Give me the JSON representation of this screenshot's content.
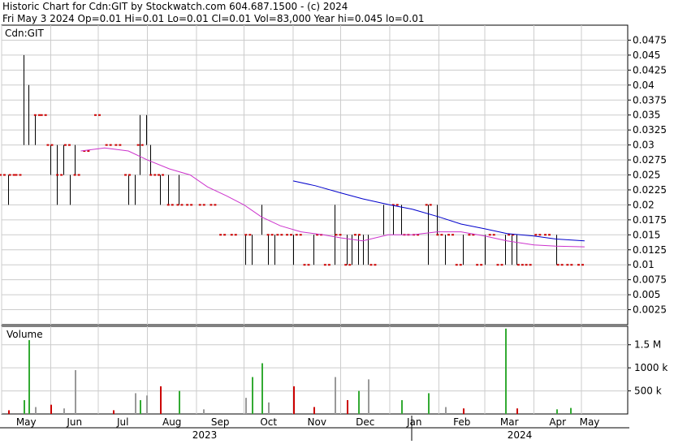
{
  "header": {
    "line1": "Historic Chart for Cdn:GIT by Stockwatch.com 604.687.1500 - (c) 2024",
    "line2": "Fri May  3 2024   Op=0.01  Hi=0.01  Lo=0.01  Cl=0.01  Vol=83,000  Year hi=0.045  lo=0.01"
  },
  "chart_data": [
    {
      "type": "ohlc",
      "title": "Cdn:GIT",
      "x_axis": {
        "months": [
          "May",
          "Jun",
          "Jul",
          "Aug",
          "Sep",
          "Oct",
          "Nov",
          "Dec",
          "Jan",
          "Feb",
          "Mar",
          "Apr",
          "May"
        ],
        "years": [
          "2023",
          "2024"
        ]
      },
      "y_axis": {
        "ticks": [
          "0.0475",
          "0.045",
          "0.0425",
          "0.04",
          "0.0375",
          "0.035",
          "0.0325",
          "0.03",
          "0.0275",
          "0.025",
          "0.0225",
          "0.02",
          "0.0175",
          "0.015",
          "0.0125",
          "0.01",
          "0.0075",
          "0.005",
          "0.0025"
        ],
        "ylim": [
          0,
          0.05
        ]
      },
      "grid": true,
      "series": [
        {
          "color": "#000000",
          "bars": [
            {
              "x": "2023-05-05",
              "h": 0.025,
              "l": 0.02
            },
            {
              "x": "2023-05-15",
              "h": 0.045,
              "l": 0.03
            },
            {
              "x": "2023-05-18",
              "h": 0.04,
              "l": 0.03
            },
            {
              "x": "2023-05-22",
              "h": 0.035,
              "l": 0.03
            },
            {
              "x": "2023-06-01",
              "h": 0.03,
              "l": 0.025
            },
            {
              "x": "2023-06-05",
              "h": 0.03,
              "l": 0.02
            },
            {
              "x": "2023-06-09",
              "h": 0.03,
              "l": 0.025
            },
            {
              "x": "2023-06-13",
              "h": 0.025,
              "l": 0.02
            },
            {
              "x": "2023-06-16",
              "h": 0.03,
              "l": 0.025
            },
            {
              "x": "2023-07-20",
              "h": 0.025,
              "l": 0.02
            },
            {
              "x": "2023-07-24",
              "h": 0.025,
              "l": 0.02
            },
            {
              "x": "2023-07-27",
              "h": 0.035,
              "l": 0.025
            },
            {
              "x": "2023-07-31",
              "h": 0.035,
              "l": 0.03
            },
            {
              "x": "2023-08-03",
              "h": 0.03,
              "l": 0.025
            },
            {
              "x": "2023-08-09",
              "h": 0.025,
              "l": 0.02
            },
            {
              "x": "2023-08-14",
              "h": 0.025,
              "l": 0.02
            },
            {
              "x": "2023-08-21",
              "h": 0.025,
              "l": 0.02
            },
            {
              "x": "2023-10-02",
              "h": 0.015,
              "l": 0.01
            },
            {
              "x": "2023-10-06",
              "h": 0.015,
              "l": 0.01
            },
            {
              "x": "2023-10-12",
              "h": 0.02,
              "l": 0.015
            },
            {
              "x": "2023-10-16",
              "h": 0.015,
              "l": 0.01
            },
            {
              "x": "2023-10-20",
              "h": 0.015,
              "l": 0.01
            },
            {
              "x": "2023-11-01",
              "h": 0.015,
              "l": 0.01
            },
            {
              "x": "2023-11-14",
              "h": 0.015,
              "l": 0.01
            },
            {
              "x": "2023-11-27",
              "h": 0.02,
              "l": 0.01
            },
            {
              "x": "2023-12-05",
              "h": 0.015,
              "l": 0.01
            },
            {
              "x": "2023-12-08",
              "h": 0.015,
              "l": 0.01
            },
            {
              "x": "2023-12-12",
              "h": 0.015,
              "l": 0.01
            },
            {
              "x": "2023-12-15",
              "h": 0.015,
              "l": 0.01
            },
            {
              "x": "2023-12-18",
              "h": 0.015,
              "l": 0.01
            },
            {
              "x": "2023-12-28",
              "h": 0.02,
              "l": 0.015
            },
            {
              "x": "2024-01-03",
              "h": 0.02,
              "l": 0.015
            },
            {
              "x": "2024-01-08",
              "h": 0.02,
              "l": 0.015
            },
            {
              "x": "2024-01-25",
              "h": 0.02,
              "l": 0.01
            },
            {
              "x": "2024-01-31",
              "h": 0.02,
              "l": 0.015
            },
            {
              "x": "2024-02-05",
              "h": 0.015,
              "l": 0.01
            },
            {
              "x": "2024-02-16",
              "h": 0.015,
              "l": 0.01
            },
            {
              "x": "2024-03-01",
              "h": 0.015,
              "l": 0.01
            },
            {
              "x": "2024-03-14",
              "h": 0.015,
              "l": 0.01
            },
            {
              "x": "2024-03-18",
              "h": 0.015,
              "l": 0.01
            },
            {
              "x": "2024-03-21",
              "h": 0.015,
              "l": 0.01
            },
            {
              "x": "2024-04-15",
              "h": 0.015,
              "l": 0.01
            }
          ]
        },
        {
          "color": "#cc0000",
          "ticks": [
            {
              "x": "2023-05-02",
              "v": 0.025
            },
            {
              "x": "2023-05-08",
              "v": 0.025
            },
            {
              "x": "2023-05-12",
              "v": 0.025
            },
            {
              "x": "2023-05-24",
              "v": 0.035
            },
            {
              "x": "2023-05-28",
              "v": 0.035
            },
            {
              "x": "2023-06-01",
              "v": 0.03
            },
            {
              "x": "2023-06-07",
              "v": 0.025
            },
            {
              "x": "2023-06-12",
              "v": 0.03
            },
            {
              "x": "2023-06-18",
              "v": 0.025
            },
            {
              "x": "2023-06-24",
              "v": 0.029
            },
            {
              "x": "2023-07-01",
              "v": 0.035
            },
            {
              "x": "2023-07-08",
              "v": 0.03
            },
            {
              "x": "2023-07-14",
              "v": 0.03
            },
            {
              "x": "2023-07-20",
              "v": 0.025
            },
            {
              "x": "2023-07-28",
              "v": 0.03
            },
            {
              "x": "2023-08-05",
              "v": 0.025
            },
            {
              "x": "2023-08-10",
              "v": 0.025
            },
            {
              "x": "2023-08-16",
              "v": 0.02
            },
            {
              "x": "2023-08-22",
              "v": 0.02
            },
            {
              "x": "2023-08-28",
              "v": 0.02
            },
            {
              "x": "2023-09-05",
              "v": 0.02
            },
            {
              "x": "2023-09-12",
              "v": 0.02
            },
            {
              "x": "2023-09-18",
              "v": 0.015
            },
            {
              "x": "2023-09-25",
              "v": 0.015
            },
            {
              "x": "2023-10-04",
              "v": 0.015
            },
            {
              "x": "2023-10-18",
              "v": 0.015
            },
            {
              "x": "2023-10-24",
              "v": 0.015
            },
            {
              "x": "2023-10-30",
              "v": 0.015
            },
            {
              "x": "2023-11-05",
              "v": 0.015
            },
            {
              "x": "2023-11-10",
              "v": 0.01
            },
            {
              "x": "2023-11-18",
              "v": 0.015
            },
            {
              "x": "2023-11-23",
              "v": 0.01
            },
            {
              "x": "2023-11-30",
              "v": 0.015
            },
            {
              "x": "2023-12-06",
              "v": 0.01
            },
            {
              "x": "2023-12-12",
              "v": 0.015
            },
            {
              "x": "2023-12-22",
              "v": 0.01
            },
            {
              "x": "2024-01-05",
              "v": 0.02
            },
            {
              "x": "2024-01-12",
              "v": 0.015
            },
            {
              "x": "2024-01-18",
              "v": 0.015
            },
            {
              "x": "2024-01-26",
              "v": 0.02
            },
            {
              "x": "2024-02-02",
              "v": 0.015
            },
            {
              "x": "2024-02-09",
              "v": 0.015
            },
            {
              "x": "2024-02-14",
              "v": 0.01
            },
            {
              "x": "2024-02-22",
              "v": 0.015
            },
            {
              "x": "2024-02-27",
              "v": 0.01
            },
            {
              "x": "2024-03-06",
              "v": 0.015
            },
            {
              "x": "2024-03-11",
              "v": 0.01
            },
            {
              "x": "2024-03-18",
              "v": 0.015
            },
            {
              "x": "2024-03-24",
              "v": 0.01
            },
            {
              "x": "2024-03-29",
              "v": 0.01
            },
            {
              "x": "2024-04-04",
              "v": 0.015
            },
            {
              "x": "2024-04-10",
              "v": 0.015
            },
            {
              "x": "2024-04-18",
              "v": 0.01
            },
            {
              "x": "2024-04-24",
              "v": 0.01
            },
            {
              "x": "2024-05-01",
              "v": 0.01
            }
          ]
        },
        {
          "color": "#cc33cc",
          "points": [
            [
              "2023-06-20",
              0.029
            ],
            [
              "2023-07-05",
              0.0295
            ],
            [
              "2023-07-20",
              0.029
            ],
            [
              "2023-08-01",
              0.0275
            ],
            [
              "2023-08-15",
              0.026
            ],
            [
              "2023-08-28",
              0.025
            ],
            [
              "2023-09-08",
              0.023
            ],
            [
              "2023-09-20",
              0.0215
            ],
            [
              "2023-10-01",
              0.02
            ],
            [
              "2023-10-12",
              0.018
            ],
            [
              "2023-10-24",
              0.0165
            ],
            [
              "2023-11-06",
              0.0155
            ],
            [
              "2023-11-20",
              0.015
            ],
            [
              "2023-12-01",
              0.0145
            ],
            [
              "2023-12-15",
              0.014
            ],
            [
              "2023-12-31",
              0.015
            ],
            [
              "2024-01-15",
              0.015
            ],
            [
              "2024-01-31",
              0.0155
            ],
            [
              "2024-02-15",
              0.0155
            ],
            [
              "2024-03-01",
              0.0148
            ],
            [
              "2024-03-15",
              0.014
            ],
            [
              "2024-04-01",
              0.0133
            ],
            [
              "2024-04-15",
              0.0131
            ],
            [
              "2024-05-03",
              0.013
            ]
          ]
        },
        {
          "color": "#0000cc",
          "points": [
            [
              "2023-11-01",
              0.024
            ],
            [
              "2023-11-15",
              0.0232
            ],
            [
              "2023-12-01",
              0.022
            ],
            [
              "2023-12-15",
              0.021
            ],
            [
              "2024-01-01",
              0.02
            ],
            [
              "2024-01-15",
              0.0193
            ],
            [
              "2024-02-01",
              0.018
            ],
            [
              "2024-02-15",
              0.0168
            ],
            [
              "2024-03-01",
              0.016
            ],
            [
              "2024-03-15",
              0.0152
            ],
            [
              "2024-04-01",
              0.0148
            ],
            [
              "2024-04-15",
              0.0143
            ],
            [
              "2024-05-03",
              0.014
            ]
          ]
        }
      ]
    },
    {
      "type": "bar",
      "title": "Volume",
      "y_axis": {
        "ticks": [
          "1.5 M",
          "1000 k",
          "500 k"
        ],
        "ylim": [
          0,
          1900000
        ]
      },
      "colors": {
        "up": "#33aa33",
        "down": "#cc0000",
        "flat": "#999999"
      },
      "bars": [
        {
          "x": "2023-05-05",
          "v": 80000,
          "c": "down"
        },
        {
          "x": "2023-05-15",
          "v": 300000,
          "c": "up"
        },
        {
          "x": "2023-05-18",
          "v": 1600000,
          "c": "up"
        },
        {
          "x": "2023-05-22",
          "v": 150000,
          "c": "flat"
        },
        {
          "x": "2023-06-01",
          "v": 200000,
          "c": "down"
        },
        {
          "x": "2023-06-09",
          "v": 120000,
          "c": "flat"
        },
        {
          "x": "2023-06-16",
          "v": 950000,
          "c": "flat"
        },
        {
          "x": "2023-07-10",
          "v": 80000,
          "c": "down"
        },
        {
          "x": "2023-07-24",
          "v": 450000,
          "c": "flat"
        },
        {
          "x": "2023-07-27",
          "v": 300000,
          "c": "up"
        },
        {
          "x": "2023-07-31",
          "v": 400000,
          "c": "flat"
        },
        {
          "x": "2023-08-09",
          "v": 600000,
          "c": "down"
        },
        {
          "x": "2023-08-21",
          "v": 500000,
          "c": "up"
        },
        {
          "x": "2023-09-05",
          "v": 100000,
          "c": "flat"
        },
        {
          "x": "2023-10-02",
          "v": 350000,
          "c": "flat"
        },
        {
          "x": "2023-10-06",
          "v": 800000,
          "c": "up"
        },
        {
          "x": "2023-10-12",
          "v": 1100000,
          "c": "up"
        },
        {
          "x": "2023-10-16",
          "v": 250000,
          "c": "flat"
        },
        {
          "x": "2023-11-01",
          "v": 600000,
          "c": "down"
        },
        {
          "x": "2023-11-14",
          "v": 150000,
          "c": "down"
        },
        {
          "x": "2023-11-27",
          "v": 800000,
          "c": "flat"
        },
        {
          "x": "2023-12-05",
          "v": 300000,
          "c": "down"
        },
        {
          "x": "2023-12-12",
          "v": 500000,
          "c": "up"
        },
        {
          "x": "2023-12-18",
          "v": 750000,
          "c": "flat"
        },
        {
          "x": "2024-01-08",
          "v": 300000,
          "c": "up"
        },
        {
          "x": "2024-01-25",
          "v": 450000,
          "c": "up"
        },
        {
          "x": "2024-02-05",
          "v": 150000,
          "c": "flat"
        },
        {
          "x": "2024-02-16",
          "v": 120000,
          "c": "down"
        },
        {
          "x": "2024-03-14",
          "v": 1850000,
          "c": "up"
        },
        {
          "x": "2024-03-21",
          "v": 120000,
          "c": "down"
        },
        {
          "x": "2024-04-15",
          "v": 100000,
          "c": "up"
        },
        {
          "x": "2024-04-24",
          "v": 130000,
          "c": "up"
        }
      ]
    }
  ]
}
